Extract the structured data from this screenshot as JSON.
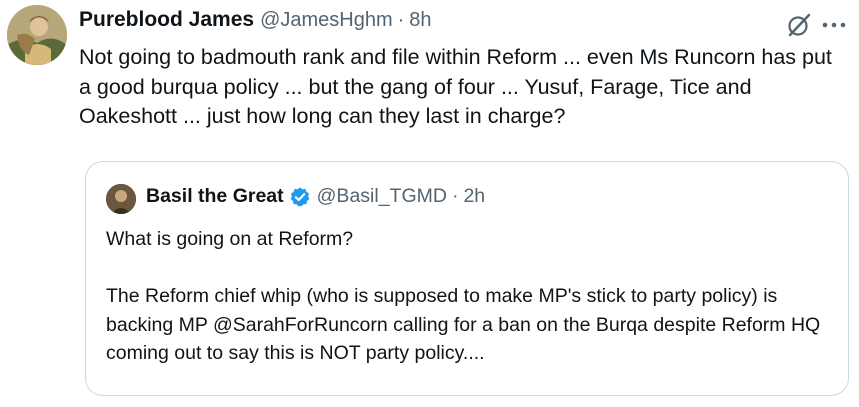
{
  "tweet": {
    "author_name": "Pureblood James",
    "author_handle": "@JamesHghm",
    "separator": "·",
    "time": "8h",
    "text": "Not going to badmouth rank and file within Reform ... even Ms Runcorn has put a good burqua policy ... but the gang of four ... Yusuf, Farage, Tice and Oakeshott ... just how long can they last in charge?",
    "icons": {
      "grok": "grok-icon",
      "more": "more-options-icon",
      "avatar": "avatar"
    }
  },
  "quote": {
    "author_name": "Basil the Great",
    "author_handle": "@Basil_TGMD",
    "separator": "·",
    "time": "2h",
    "text": "What is going on at Reform?\n\nThe Reform chief whip (who is supposed to make MP's stick to party policy) is backing MP @SarahForRuncorn calling for a ban on the Burqa despite Reform HQ coming out to say this is NOT party policy....",
    "verified": true,
    "icons": {
      "verified": "verified-badge-icon"
    }
  },
  "colors": {
    "text": "#0f1419",
    "secondary": "#536471",
    "border": "#cfd9de",
    "verified_blue": "#1d9bf0"
  }
}
